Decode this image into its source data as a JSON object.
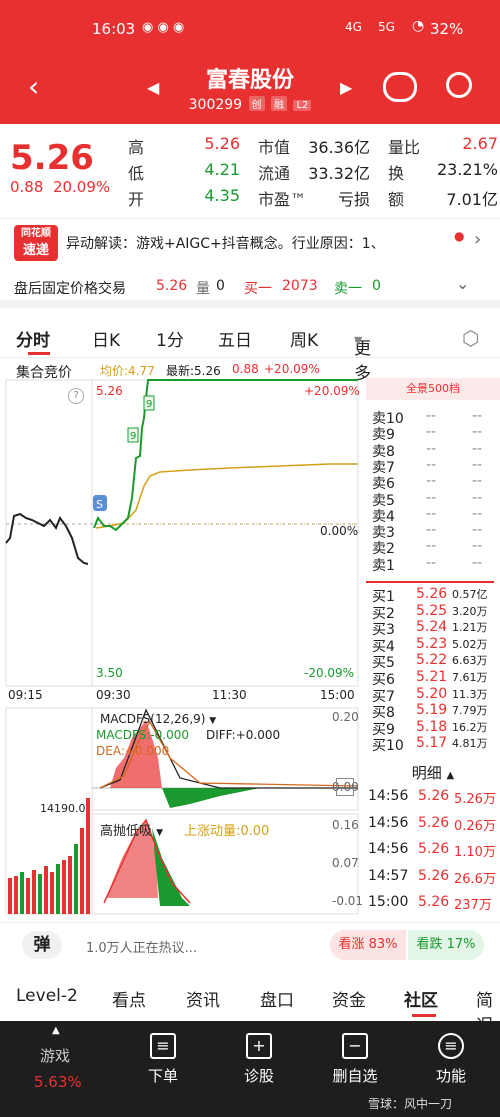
{
  "status_bar": {
    "time": "16:03",
    "signal1": "4G",
    "signal2": "5G",
    "battery": "32%"
  },
  "header": {
    "title": "富春股份",
    "code": "300299",
    "tags": [
      "创",
      "融",
      "L2"
    ]
  },
  "quote": {
    "price": "5.26",
    "change": "0.88",
    "change_pct": "20.09%",
    "fields": [
      {
        "label": "高",
        "value": "5.26",
        "color": "red"
      },
      {
        "label": "低",
        "value": "4.21",
        "color": "green"
      },
      {
        "label": "开",
        "value": "4.35",
        "color": "green"
      }
    ],
    "fields2": [
      {
        "label": "市值",
        "value": "36.36亿"
      },
      {
        "label": "流通",
        "value": "33.32亿"
      },
      {
        "label": "市盈™",
        "value": "亏损"
      }
    ],
    "fields3": [
      {
        "label": "量比",
        "value": "2.67"
      },
      {
        "label": "换",
        "value": "23.21%"
      },
      {
        "label": "额",
        "value": "7.01亿"
      }
    ]
  },
  "news": {
    "logo_line1": "同花顺",
    "logo_line2": "速递",
    "text": "异动解读：游戏+AIGC+抖音概念。行业原因：1、"
  },
  "after_hours": {
    "label": "盘后固定价格交易",
    "price": "5.26",
    "vol_label": "量",
    "vol": "0",
    "buy_label": "买一",
    "buy": "2073",
    "sell_label": "卖一",
    "sell": "0"
  },
  "tabs": [
    "分时",
    "日K",
    "1分",
    "五日",
    "周K",
    "更多"
  ],
  "chart": {
    "mode": "集合竞价",
    "avg_label": "均价:4.77",
    "latest_label": "最新:5.26",
    "latest_chg": "0.88",
    "latest_pct": "+20.09%",
    "y_top": "5.26",
    "y_top_pct": "+20.09%",
    "y_mid_pct": "0.00%",
    "y_bottom": "3.50",
    "y_bottom_pct": "-20.09%",
    "times": [
      "09:15",
      "09:30",
      "11:30",
      "15:00"
    ],
    "vol_label": "14190.0",
    "macd_title": "MACDFS(12,26,9)",
    "macd_line": "MACDFS:-0.000",
    "diff_line": "DIFF:+0.000",
    "dea_line": "DEA:+0.000",
    "macd_axis": [
      "0.20",
      "0.00"
    ],
    "ind2_title": "高抛低吸",
    "ind2_sub": "上涨动量:0.00",
    "ind2_axis": [
      "0.16",
      "0.07",
      "-0.01"
    ],
    "s_marker": "S",
    "nine_markers": [
      "9",
      "9"
    ]
  },
  "order_book": {
    "title": "全景500档",
    "asks": [
      {
        "label": "卖10",
        "price": "--",
        "vol": "--"
      },
      {
        "label": "卖9",
        "price": "--",
        "vol": "--"
      },
      {
        "label": "卖8",
        "price": "--",
        "vol": "--"
      },
      {
        "label": "卖7",
        "price": "--",
        "vol": "--"
      },
      {
        "label": "卖6",
        "price": "--",
        "vol": "--"
      },
      {
        "label": "卖5",
        "price": "--",
        "vol": "--"
      },
      {
        "label": "卖4",
        "price": "--",
        "vol": "--"
      },
      {
        "label": "卖3",
        "price": "--",
        "vol": "--"
      },
      {
        "label": "卖2",
        "price": "--",
        "vol": "--"
      },
      {
        "label": "卖1",
        "price": "--",
        "vol": "--"
      }
    ],
    "bids": [
      {
        "label": "买1",
        "price": "5.26",
        "vol": "0.57亿"
      },
      {
        "label": "买2",
        "price": "5.25",
        "vol": "3.20万"
      },
      {
        "label": "买3",
        "price": "5.24",
        "vol": "1.21万"
      },
      {
        "label": "买4",
        "price": "5.23",
        "vol": "5.02万"
      },
      {
        "label": "买5",
        "price": "5.22",
        "vol": "6.63万"
      },
      {
        "label": "买6",
        "price": "5.21",
        "vol": "7.61万"
      },
      {
        "label": "买7",
        "price": "5.20",
        "vol": "11.3万"
      },
      {
        "label": "买8",
        "price": "5.19",
        "vol": "7.79万"
      },
      {
        "label": "买9",
        "price": "5.18",
        "vol": "16.2万"
      },
      {
        "label": "买10",
        "price": "5.17",
        "vol": "4.81万"
      }
    ]
  },
  "detail": {
    "title": "明细",
    "rows": [
      {
        "time": "14:56",
        "price": "5.26",
        "vol": "5.26万"
      },
      {
        "time": "14:56",
        "price": "5.26",
        "vol": "0.26万"
      },
      {
        "time": "14:56",
        "price": "5.26",
        "vol": "1.10万"
      },
      {
        "time": "14:57",
        "price": "5.26",
        "vol": "26.6万"
      },
      {
        "time": "15:00",
        "price": "5.26",
        "vol": "237万"
      }
    ]
  },
  "discussion": {
    "icon_text": "弹",
    "hot_text": "1.0万人正在热议...",
    "bull_label": "看涨",
    "bull_pct": "83%",
    "bear_label": "看跌",
    "bear_pct": "17%"
  },
  "footer_tabs": [
    "Level-2",
    "看点",
    "资讯",
    "盘口",
    "资金",
    "社区",
    "简况"
  ],
  "bottom_nav": {
    "sector": "游戏",
    "sector_pct": "5.63%",
    "items": [
      "下单",
      "诊股",
      "删自选",
      "功能"
    ],
    "watermark": "雪球：风中一刀"
  },
  "colors": {
    "red": "#e93030",
    "green": "#1a9a2e",
    "avg": "#d4a017"
  }
}
